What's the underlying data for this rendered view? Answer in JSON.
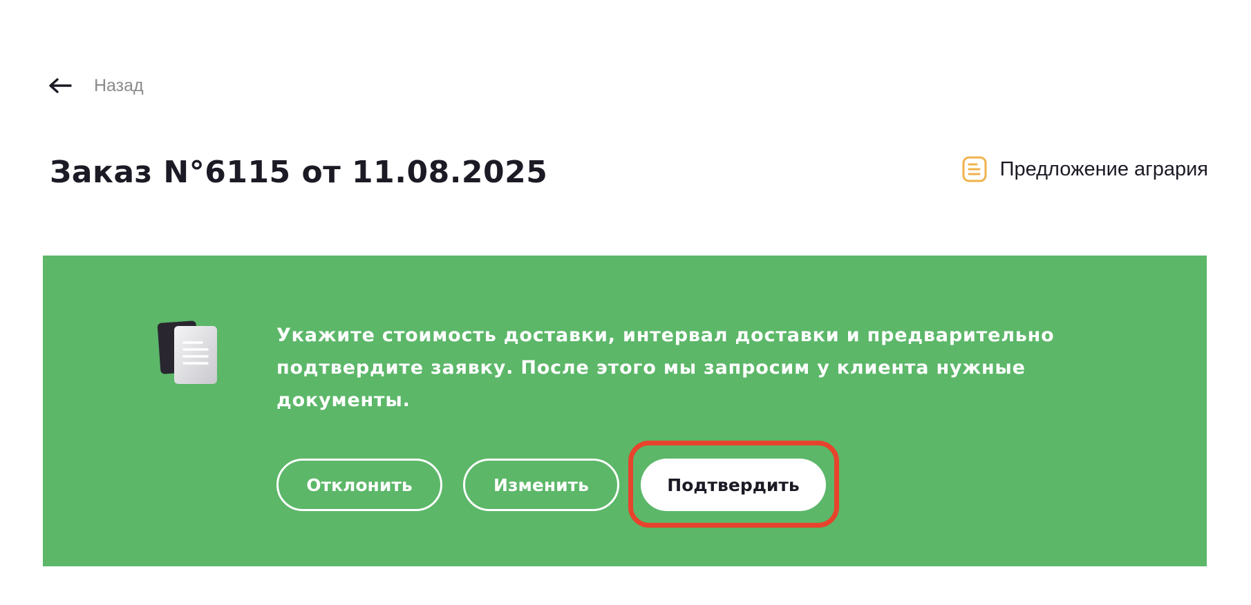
{
  "header": {
    "back_label": "Назад",
    "title": "Заказ N°6115 от 11.08.2025",
    "proposal_label": "Предложение агрария"
  },
  "banner": {
    "message": "Укажите стоимость доставки, интервал доставки и предварительно подтвердите заявку. После этого мы запросим у клиента нужные документы.",
    "buttons": {
      "reject": "Отклонить",
      "edit": "Изменить",
      "confirm": "Подтвердить"
    }
  },
  "icons": {
    "back": "arrow-left-icon",
    "proposal": "document-icon",
    "banner": "documents-stack-icon"
  },
  "colors": {
    "banner_bg": "#5cb769",
    "accent_orange": "#f0b24a",
    "highlight_red": "#e8432c",
    "text_dark": "#1c1a24"
  }
}
